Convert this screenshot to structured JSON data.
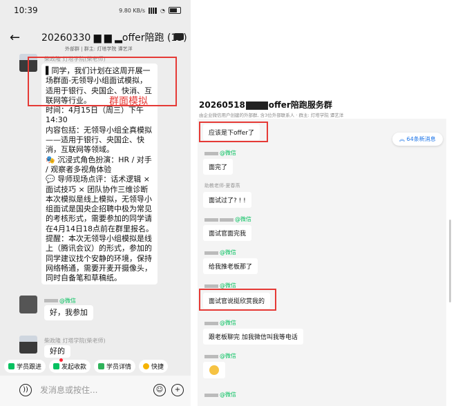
{
  "phone": {
    "status_time": "10:39",
    "status_speed": "9.80 KB/s",
    "title": "20260330 ▆ ▆ ▂offer陪跑 (13)",
    "subtitle": "外部群 | 群主: 灯塔学院 谭艺洋",
    "sender1": "柴政隆 灯塔学院(柴老师)",
    "message1": "▌同学，我们计划在这周开展一场群面-无领导小组面试模拟，适用于银行、央国企、快消、互联网等行业。\n时间：4月15日（周三）下午14:30\n内容包括：无领导小组全真模拟——适用于银行、央国企、快消，互联网等领域。\n🎭 沉浸式角色扮演：HR / 对手 / 观察者多视角体验\n💬 导师现场点评：话术逻辑 × 面试技巧 × 团队协作三维诊断\n本次模拟是线上模拟，无领导小组面试是国央企招聘中极为常见的考核形式，需要参加的同学请在4月14日18点前在群里报名。\n提醒：本次无领导小组模拟是线上（腾讯会议）的形式，参加的同学建议找个安静的环境，保持网络畅通，需要开麦开摄像头，同时自备笔和草稿纸。",
    "annotation": "群面模拟",
    "sender2_tag": "@微信",
    "message2": "好，我参加",
    "sender3": "柴政隆 灯塔学院(柴老师)",
    "message3": "好的",
    "toolbar": [
      "学员跟进",
      "发起收款",
      "学员详情",
      "快捷"
    ],
    "input_placeholder": "发消息或按住..."
  },
  "panel": {
    "title_prefix": "20260518",
    "title_suffix": "offer陪跑服务群",
    "subtitle": "由企业微信用户创建的外部群, 含3位外部联系人 · 群主: 灯塔学院 谭艺洋",
    "new_messages": "64条新消息",
    "msg1": "应该是下offer了",
    "tag": "@微信",
    "msg2": "面完了",
    "assistant": "助教老师-夏春燕",
    "msg3": "面试过了? ! !",
    "msg4": "面试官面完我",
    "msg5": "给我推老板那了",
    "msg6": "面试官说挺欣赏我的",
    "msg7": "跟老板聊完 加我微信叫我等电话"
  },
  "colors": {
    "annotation_red": "#e53935",
    "wechat_green": "#07c160",
    "link_blue": "#1a73e8"
  }
}
